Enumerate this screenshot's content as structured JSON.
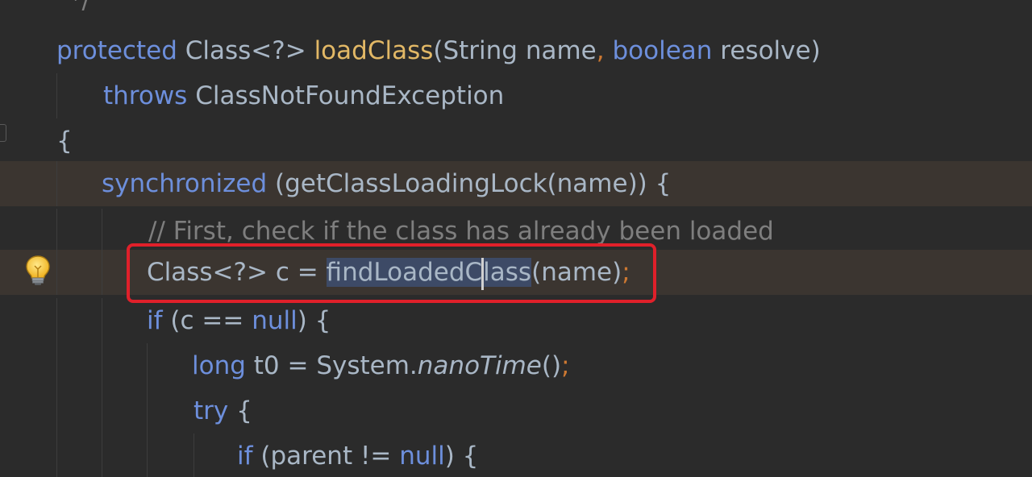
{
  "code_lines": [
    {
      "top_fragment": "*/"
    },
    {
      "t1": "protected",
      "t2": " Class<?> ",
      "t3": "loadClass",
      "t4": "(String name",
      "t5": ",",
      "t6": " ",
      "t7": "boolean",
      "t8": " resolve)"
    },
    {
      "t1": "throws",
      "t2": " ClassNotFoundException"
    },
    {
      "t1": "{"
    },
    {
      "t1": "synchronized",
      "t2": " (getClassLoadingLock(name)) {"
    },
    {
      "t1": "// First, check if the class has already been loaded"
    },
    {
      "t1": "Class<?> c = ",
      "t2": "findLoadedC",
      "t3": "lass",
      "t4": "(name)",
      "t5": ";"
    },
    {
      "t1": "if",
      "t2": " (c == ",
      "t3": "null",
      "t4": ") {"
    },
    {
      "t1": "long",
      "t2": " t0 = System.",
      "t3": "nanoTime",
      "t4": "()",
      "t5": ";"
    },
    {
      "t1": "try",
      "t2": " {"
    },
    {
      "t1": "if",
      "t2": " (parent != ",
      "t3": "null",
      "t4": ") {"
    }
  ],
  "icons": {
    "intention": "lightbulb-icon"
  },
  "colors": {
    "background": "#2b2b2b",
    "keyword": "#6d8fdc",
    "method": "#e2b866",
    "comment": "#7e7e7e",
    "highlight_box": "#e0202a"
  }
}
